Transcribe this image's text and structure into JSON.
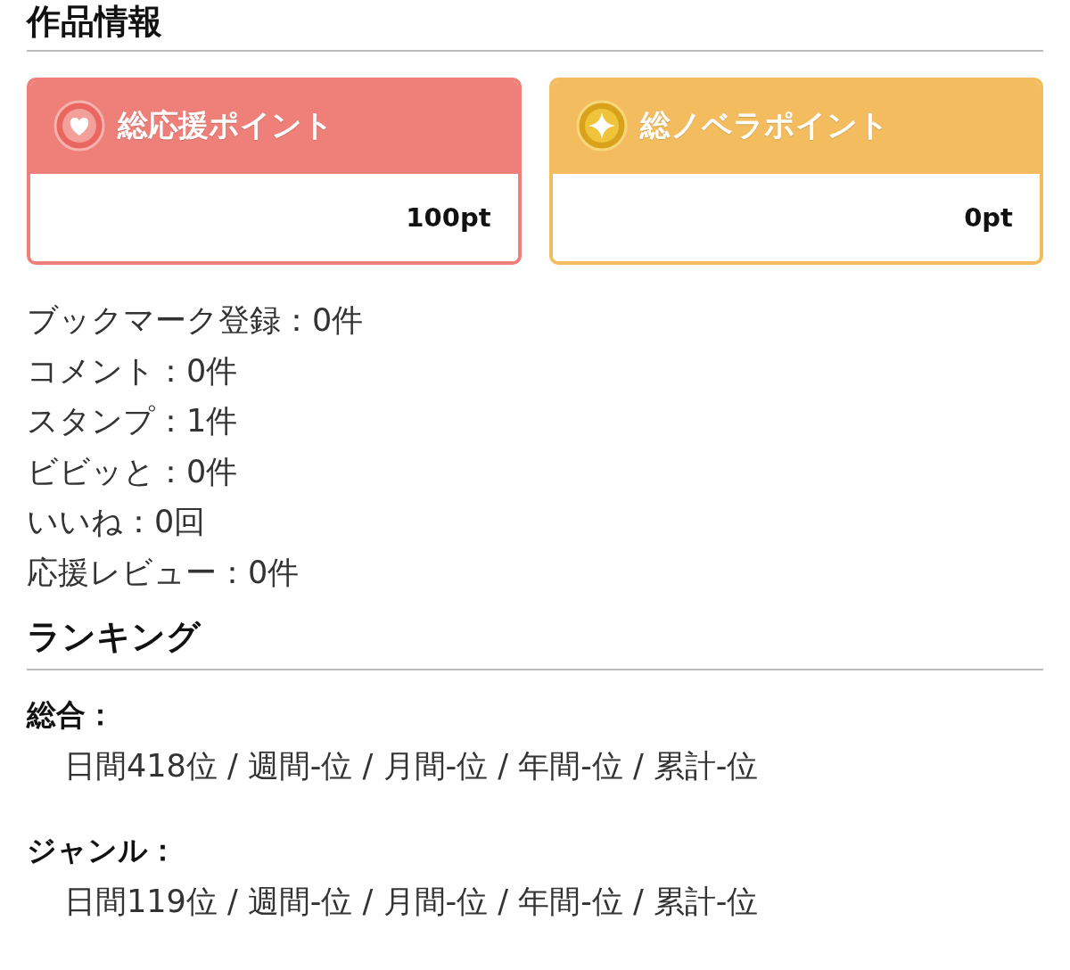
{
  "info": {
    "title": "作品情報",
    "cards": [
      {
        "kind": "heart",
        "label": "総応援ポイント",
        "value": "100pt",
        "color": "#ee8079"
      },
      {
        "kind": "star",
        "label": "総ノベラポイント",
        "value": "0pt",
        "color": "#f3bd5f"
      }
    ],
    "stats": [
      "ブックマーク登録：0件",
      "コメント：0件",
      "スタンプ：1件",
      "ビビッと：0件",
      "いいね：0回",
      "応援レビュー：0件"
    ]
  },
  "ranking": {
    "title": "ランキング",
    "groups": [
      {
        "label": "総合：",
        "line": "日間418位 / 週間-位 / 月間-位 / 年間-位 / 累計-位"
      },
      {
        "label": "ジャンル：",
        "line": "日間119位 / 週間-位 / 月間-位 / 年間-位 / 累計-位"
      }
    ]
  }
}
